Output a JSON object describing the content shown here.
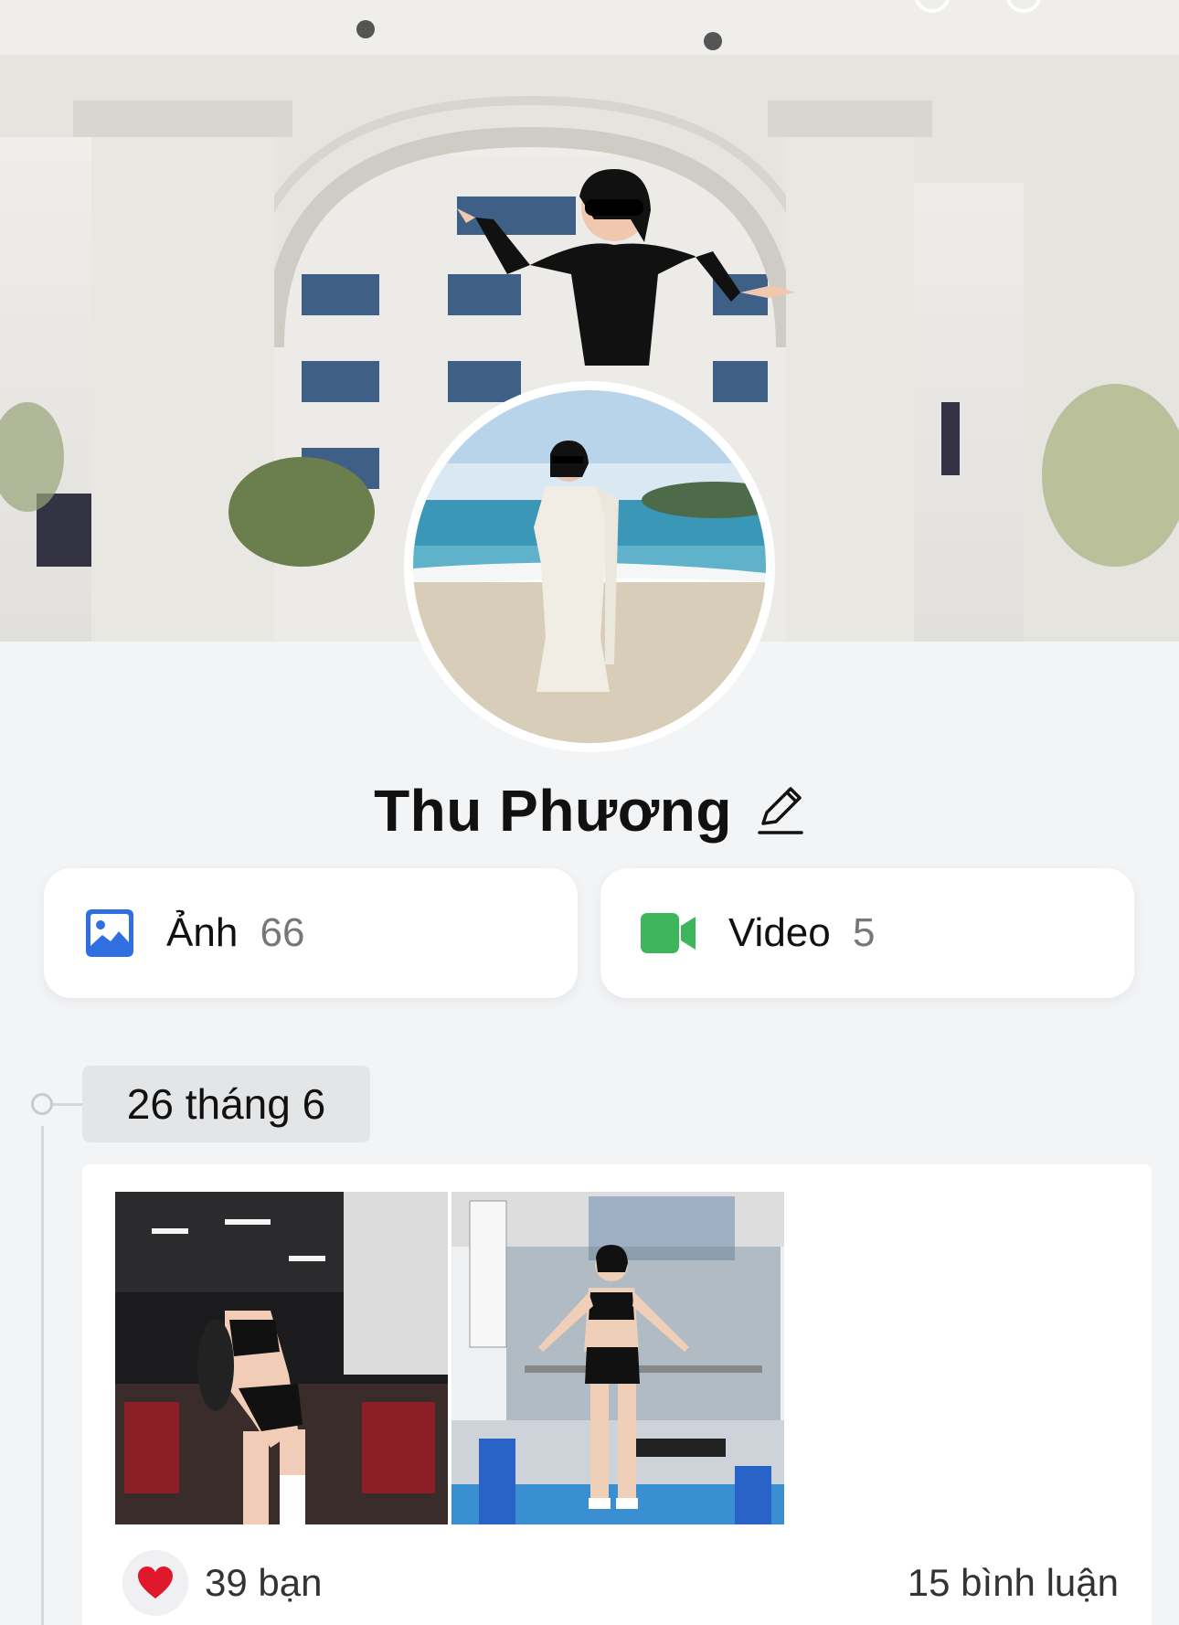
{
  "profile": {
    "name": "Thu Phương"
  },
  "media": {
    "photos": {
      "label": "Ảnh",
      "count": "66"
    },
    "videos": {
      "label": "Video",
      "count": "5"
    }
  },
  "timeline": {
    "date_label": "26 tháng 6"
  },
  "post": {
    "reactions_label": "39 bạn",
    "comments_label": "15 bình luận"
  },
  "colors": {
    "photo_icon": "#2f6fe0",
    "video_icon": "#3fb55b",
    "heart": "#e0182d"
  },
  "icons": {
    "photo": "image-icon",
    "video": "video-camera-icon",
    "edit": "pencil-icon",
    "reaction": "heart-icon"
  }
}
